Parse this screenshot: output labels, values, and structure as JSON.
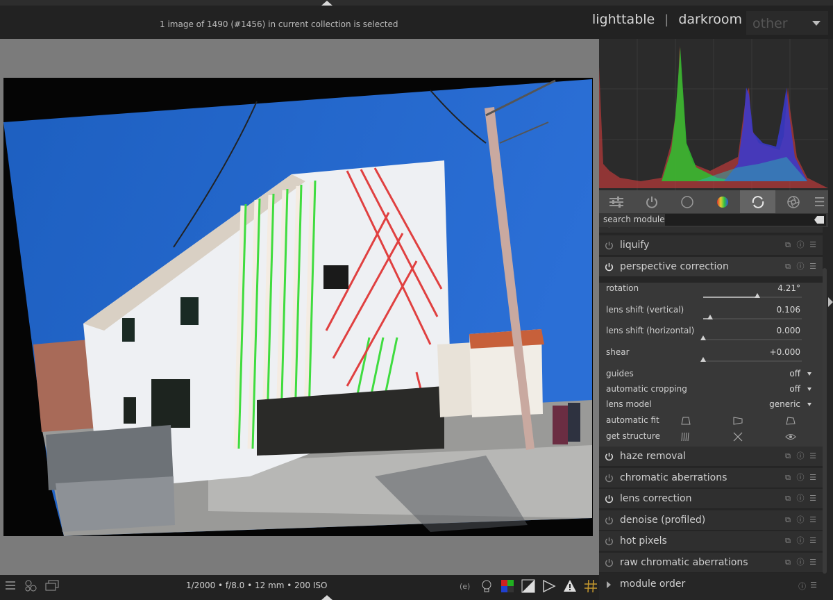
{
  "header": {
    "collection_info": "1 image of 1490 (#1456) in current collection is selected",
    "views": [
      "lighttable",
      "darkroom",
      "other"
    ],
    "separator": "|"
  },
  "histogram": {
    "channels": [
      "red",
      "green",
      "blue"
    ]
  },
  "module_tabs": {
    "icons": [
      "sliders-icon",
      "power-icon",
      "circle-icon",
      "color-wheel-icon",
      "refresh-icon",
      "aperture-icon",
      "menu-icon"
    ],
    "active_index": 4
  },
  "search": {
    "label": "search module",
    "placeholder": ""
  },
  "modules": {
    "partial_top": "rotation",
    "liquify": "liquify",
    "perspective": "perspective correction",
    "params": {
      "rotation": {
        "label": "rotation",
        "value": "4.21°",
        "fraction": 0.55
      },
      "lens_shift_v": {
        "label": "lens shift (vertical)",
        "value": "0.106",
        "fraction": 0.07
      },
      "lens_shift_h": {
        "label": "lens shift (horizontal)",
        "value": "0.000",
        "fraction": 0.0
      },
      "shear": {
        "label": "shear",
        "value": "+0.000",
        "fraction": 0.0
      }
    },
    "combos": {
      "guides": {
        "label": "guides",
        "value": "off"
      },
      "auto_crop": {
        "label": "automatic cropping",
        "value": "off"
      },
      "lens_model": {
        "label": "lens model",
        "value": "generic"
      }
    },
    "buttons": {
      "auto_fit": "automatic fit",
      "get_structure": "get structure"
    },
    "list": [
      "haze removal",
      "chromatic aberrations",
      "lens correction",
      "denoise (profiled)",
      "hot pixels",
      "raw chromatic aberrations"
    ],
    "module_order": "module order"
  },
  "footer": {
    "exif": "1/2000 • f/8.0 • 12 mm • 200 ISO"
  }
}
